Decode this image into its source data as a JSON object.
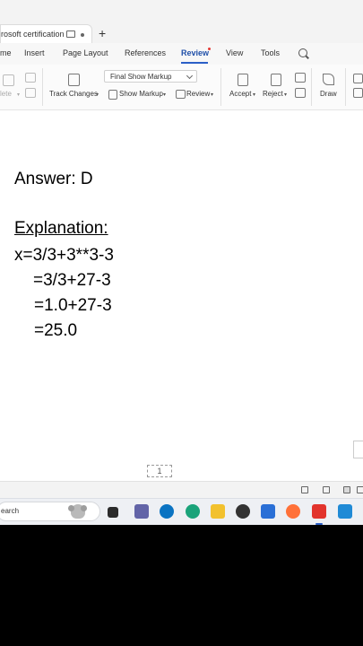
{
  "tabs": {
    "doc_title": "rosoft certification",
    "new_tab": "+"
  },
  "menu": {
    "items": [
      "me",
      "Insert",
      "Page Layout",
      "References",
      "Review",
      "View",
      "Tools"
    ],
    "active": "Review"
  },
  "toolbar": {
    "delete_label": "lete",
    "track_changes": "Track Changes",
    "markup_select": "Final Show Markup",
    "show_markup": "Show Markup",
    "review": "Review",
    "accept": "Accept",
    "reject": "Reject",
    "draw": "Draw"
  },
  "document": {
    "answer": "Answer: D",
    "explanation_heading": "Explanation:",
    "lines": [
      "x=3/3+3**3-3",
      "=3/3+27-3",
      "=1.0+27-3",
      "=25.0"
    ],
    "page_number": "1"
  },
  "taskbar": {
    "search_text": "earch"
  },
  "colors": {
    "accent": "#2b5fc7",
    "background": "#000000"
  }
}
